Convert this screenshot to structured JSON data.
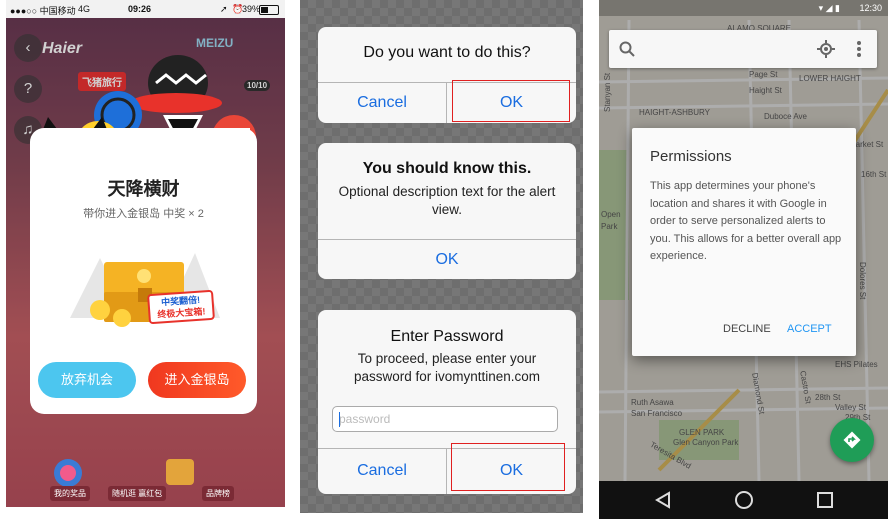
{
  "panel1": {
    "status": {
      "carrier": "●●●○○ 中国移动",
      "network": "4G",
      "time": "09:26",
      "battery": "39%",
      "battery_level": 0.39
    },
    "brand_logo": "Haier",
    "brand_meizu": "MEIZU",
    "brand_fly": "飞猪旅行",
    "counter": "10/10",
    "dialog": {
      "title": "天降横财",
      "subtitle": "带你进入金银岛 中奖 × 2",
      "ribbon_line1": "中奖翻倍!",
      "ribbon_line2": "终极大宝箱!",
      "decline_label": "放弃机会",
      "accept_label": "进入金银岛"
    },
    "tabs": [
      "我的奖品",
      "随机逛 赢红包",
      "品牌榜"
    ],
    "colors": {
      "decline": "#4cc6ef",
      "accept": "#f0381f"
    }
  },
  "panel2": {
    "alert1": {
      "title": "Do you want to do this?",
      "cancel": "Cancel",
      "ok": "OK"
    },
    "alert2": {
      "title": "You should know this.",
      "message": "Optional description text for the alert view.",
      "ok": "OK"
    },
    "alert3": {
      "title": "Enter Password",
      "message": "To proceed, please enter your password for ivomynttinen.com",
      "placeholder": "password",
      "cancel": "Cancel",
      "ok": "OK"
    },
    "colors": {
      "button": "#1a6de0",
      "highlight": "#e02020"
    }
  },
  "panel3": {
    "status": {
      "time": "12:30"
    },
    "map_labels": [
      "ALAMO SQUARE",
      "Page St",
      "LOWER HAIGHT",
      "Haight St",
      "HAIGHT-ASHBURY",
      "Duboce Ave",
      "Stanyan St",
      "Open",
      "Park",
      "Dolores St",
      "28th St",
      "Valley St",
      "29th St",
      "Ruth Asawa",
      "San Francisco",
      "GLEN PARK",
      "Glen Canyon Park",
      "EHS Pilates",
      "Diamond St",
      "Castro St",
      "Teresita Blvd",
      "16th St",
      "Market St"
    ],
    "dialog": {
      "title": "Permissions",
      "body": "This app determines your phone's location and shares it with Google in order to serve personalized alerts to you. This allows for a better overall app experience.",
      "decline": "DECLINE",
      "accept": "ACCEPT"
    },
    "icons": [
      "search-icon",
      "my-location-icon",
      "more-vert-icon",
      "directions-icon",
      "back-icon",
      "home-icon",
      "recents-icon"
    ],
    "colors": {
      "accent": "#2196f3",
      "fab": "#1f9d57"
    }
  }
}
